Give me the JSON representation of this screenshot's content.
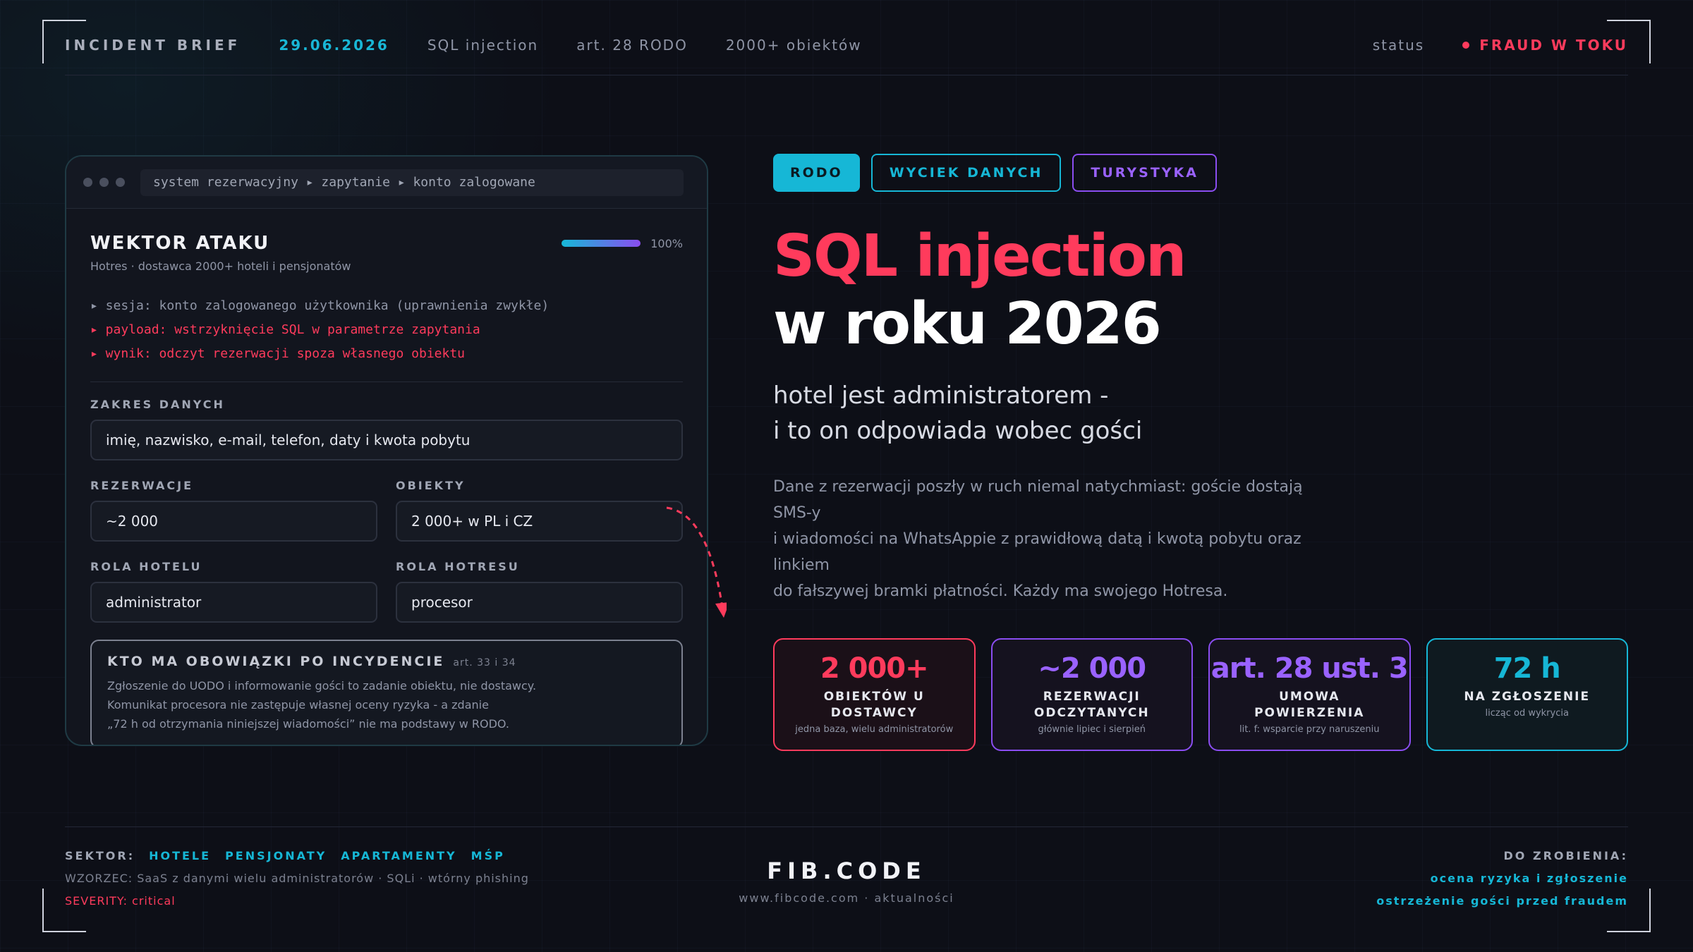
{
  "topbar": {
    "brief": "INCIDENT BRIEF",
    "date": "29.06.2026",
    "meta1": "SQL injection",
    "meta2": "art. 28 RODO",
    "meta3": "2000+ obiektów",
    "status_label": "status",
    "status_value": "FRAUD W TOKU"
  },
  "panel": {
    "breadcrumb": "system rezerwacyjny ▸ zapytanie ▸ konto zalogowane",
    "title": "WEKTOR ATAKU",
    "progress_label": "100%",
    "progress_value": 1.0,
    "subtitle": "Hotres · dostawca 2000+ hoteli i pensjonatów",
    "logs": [
      "▸ sesja: konto zalogowanego użytkownika (uprawnienia zwykłe)",
      "▸ payload: wstrzyknięcie SQL w parametrze zapytania",
      "▸ wynik: odczyt rezerwacji spoza własnego obiektu"
    ],
    "scope_label": "ZAKRES DANYCH",
    "scope_value": "imię, nazwisko, e-mail, telefon, daty i kwota pobytu",
    "reservations_label": "REZERWACJE",
    "reservations_value": "~2 000",
    "objects_label": "OBIEKTY",
    "objects_value": "2 000+ w PL i CZ",
    "hotel_role_label": "ROLA HOTELU",
    "hotel_role_value": "administrator",
    "hotres_role_label": "ROLA HOTRESU",
    "hotres_role_value": "procesor",
    "duty_title": "KTO MA OBOWIĄZKI PO INCYDENCIE",
    "duty_ref": "art. 33 i 34",
    "duty_lines": [
      "Zgłoszenie do UODO i informowanie gości to zadanie obiektu, nie dostawcy.",
      "Komunikat procesora nie zastępuje własnej oceny ryzyka - a zdanie",
      "„72 h od otrzymania niniejszej wiadomości” nie ma podstawy w RODO."
    ]
  },
  "right": {
    "tags": [
      "RODO",
      "WYCIEK DANYCH",
      "TURYSTYKA"
    ],
    "headline_line1": "SQL injection",
    "headline_line2": "w roku 2026",
    "lead_line1": "hotel jest administratorem -",
    "lead_line2": "i to on odpowiada wobec gości",
    "desc_lines": [
      "Dane z rezerwacji poszły w ruch niemal natychmiast: goście dostają SMS-y",
      "i wiadomości na WhatsAppie z prawidłową datą i kwotą pobytu oraz linkiem",
      "do fałszywej bramki płatności. Każdy ma swojego Hotresa."
    ],
    "stats": [
      {
        "value": "2 000+",
        "label": "OBIEKTÓW U DOSTAWCY",
        "note": "jedna baza, wielu administratorów"
      },
      {
        "value": "~2 000",
        "label": "REZERWACJI ODCZYTANYCH",
        "note": "głównie lipiec i sierpień"
      },
      {
        "value": "art. 28 ust. 3",
        "label": "UMOWA POWIERZENIA",
        "note": "lit. f: wsparcie przy naruszeniu"
      },
      {
        "value": "72 h",
        "label": "NA ZGŁOSZENIE",
        "note": "licząc od wykrycia"
      }
    ]
  },
  "footer": {
    "sector_label": "SEKTOR:",
    "sectors": [
      "HOTELE",
      "PENSJONATY",
      "APARTAMENTY",
      "MŚP"
    ],
    "pattern": "WZORZEC: SaaS z danymi wielu administratorów · SQLi · wtórny phishing",
    "severity": "SEVERITY: critical",
    "logo": "FIB.CODE",
    "url": "www.fibcode.com · aktualności",
    "todo_label": "DO ZROBIENIA:",
    "todo_items": [
      "ocena ryzyka i zgłoszenie",
      "ostrzeżenie gości przed fraudem"
    ]
  },
  "colors": {
    "accent_cyan": "#16b7d6",
    "accent_red": "#ff3b5c",
    "accent_purple": "#8a4df0",
    "background": "#0d0f17"
  }
}
